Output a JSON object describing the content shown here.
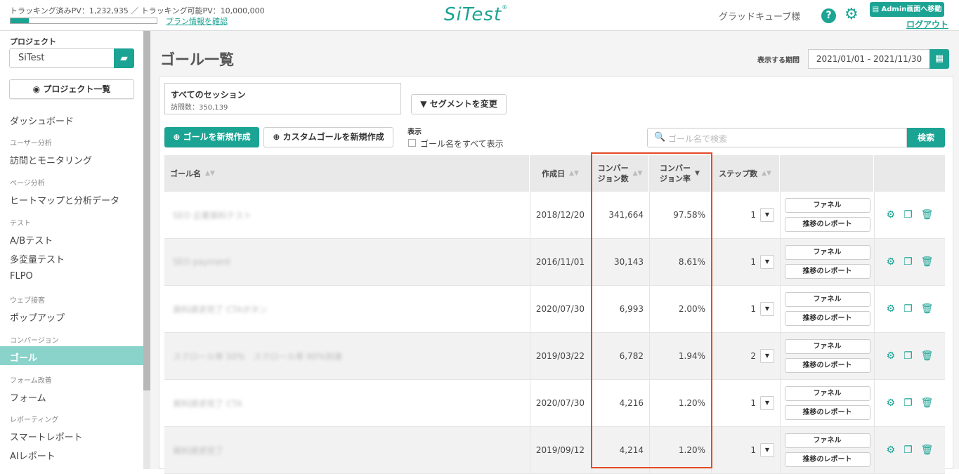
{
  "topbar": {
    "pv_text": "トラッキング済みPV：1,232,935 ／ トラッキング可能PV：10,000,000",
    "pv_progress": 0.123,
    "plan_link": "プラン情報を確認",
    "logo": "SiTest",
    "user_name": "グラッドキューブ様",
    "help_icon": "?",
    "admin_button": "Admin画面へ移動",
    "logout": "ログアウト"
  },
  "sidebar": {
    "project_label": "プロジェクト",
    "project_value": "SiTest",
    "project_list_button": "プロジェクト一覧",
    "dashboard": "ダッシュボード",
    "sec_user": "ユーザー分析",
    "visit_monitoring": "訪問とモニタリング",
    "sec_page": "ページ分析",
    "heatmap": "ヒートマップと分析データ",
    "sec_test": "テスト",
    "ab_test": "A/Bテスト",
    "multivariate": "多変量テスト",
    "flpo": "FLPO",
    "sec_web": "ウェブ接客",
    "popup": "ポップアップ",
    "sec_conversion": "コンバージョン",
    "goal": "ゴール",
    "sec_form": "フォーム改善",
    "form": "フォーム",
    "sec_report": "レポーティング",
    "smart_report": "スマートレポート",
    "ai_report": "AIレポート"
  },
  "main": {
    "title": "ゴール一覧",
    "period_label": "表示する期間",
    "period_value": "2021/01/01 - 2021/11/30",
    "session_title": "すべてのセッション",
    "session_visits": "訪問数：350,139",
    "segment_button": "セグメントを変更",
    "new_goal_button": "ゴールを新規作成",
    "custom_goal_button": "カスタムゴールを新規作成",
    "display_label": "表示",
    "show_all_label": "ゴール名をすべて表示",
    "search_placeholder": "ゴール名で検索",
    "search_button": "検索"
  },
  "table": {
    "headers": {
      "name": "ゴール名",
      "created": "作成日",
      "conv_count_1": "コンバー",
      "conv_count_2": "ジョン数",
      "conv_rate_1": "コンバー",
      "conv_rate_2": "ジョン率",
      "steps": "ステップ数"
    },
    "funnel_label": "ファネル",
    "trend_label": "推移のレポート",
    "rows": [
      {
        "name": "SEO 企業資料テスト",
        "created": "2018/12/20",
        "conversions": "341,664",
        "rate": "97.58%",
        "steps": "1"
      },
      {
        "name": "SEO payment",
        "created": "2016/11/01",
        "conversions": "30,143",
        "rate": "8.61%",
        "steps": "1"
      },
      {
        "name": "資料請求完了 CTAボタン",
        "created": "2020/07/30",
        "conversions": "6,993",
        "rate": "2.00%",
        "steps": "1"
      },
      {
        "name": "スクロール率 50%　スクロール率 90%到達",
        "created": "2019/03/22",
        "conversions": "6,782",
        "rate": "1.94%",
        "steps": "2"
      },
      {
        "name": "資料請求完了 CTA",
        "created": "2020/07/30",
        "conversions": "4,216",
        "rate": "1.20%",
        "steps": "1"
      },
      {
        "name": "資料請求完了",
        "created": "2019/09/12",
        "conversions": "4,214",
        "rate": "1.20%",
        "steps": "1"
      }
    ]
  }
}
